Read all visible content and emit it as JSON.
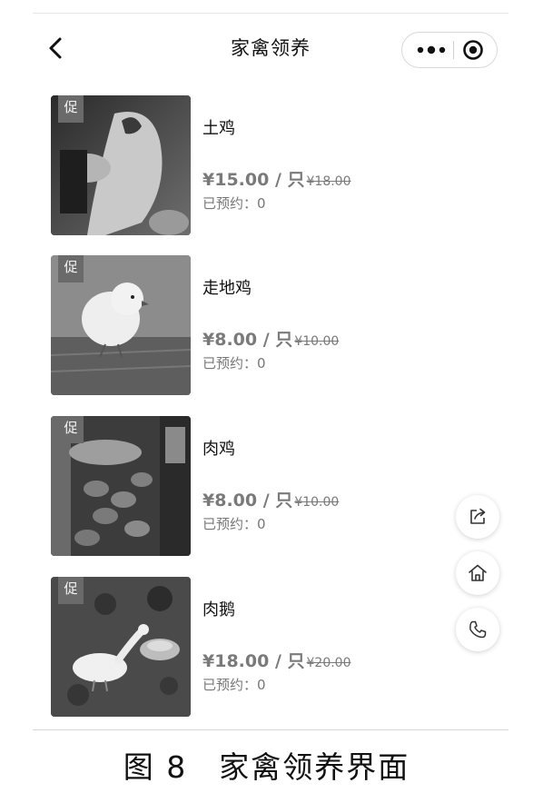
{
  "nav": {
    "title": "家禽领养",
    "back_icon": "back-arrow-icon",
    "more_icon": "more-dots-icon",
    "close_icon": "target-circle-icon"
  },
  "products": [
    {
      "badge": "促",
      "name": "土鸡",
      "price": "¥15.00",
      "unit": " / 只",
      "original_price": "¥18.00",
      "reserved_label": "已预约：",
      "reserved_count": "0",
      "image": "chicken-being-held"
    },
    {
      "badge": "促",
      "name": "走地鸡",
      "price": "¥8.00",
      "unit": " / 只",
      "original_price": "¥10.00",
      "reserved_label": "已预约：",
      "reserved_count": "0",
      "image": "chick-on-wood"
    },
    {
      "badge": "促",
      "name": "肉鸡",
      "price": "¥8.00",
      "unit": " / 只",
      "original_price": "¥10.00",
      "reserved_label": "已预约：",
      "reserved_count": "0",
      "image": "broilers-in-barn"
    },
    {
      "badge": "促",
      "name": "肉鹅",
      "price": "¥18.00",
      "unit": " / 只",
      "original_price": "¥20.00",
      "reserved_label": "已预约：",
      "reserved_count": "0",
      "image": "geese-in-yard"
    }
  ],
  "fabs": {
    "share_icon": "share-icon",
    "home_icon": "home-icon",
    "phone_icon": "phone-icon"
  },
  "caption": "图 8　家禽领养界面"
}
